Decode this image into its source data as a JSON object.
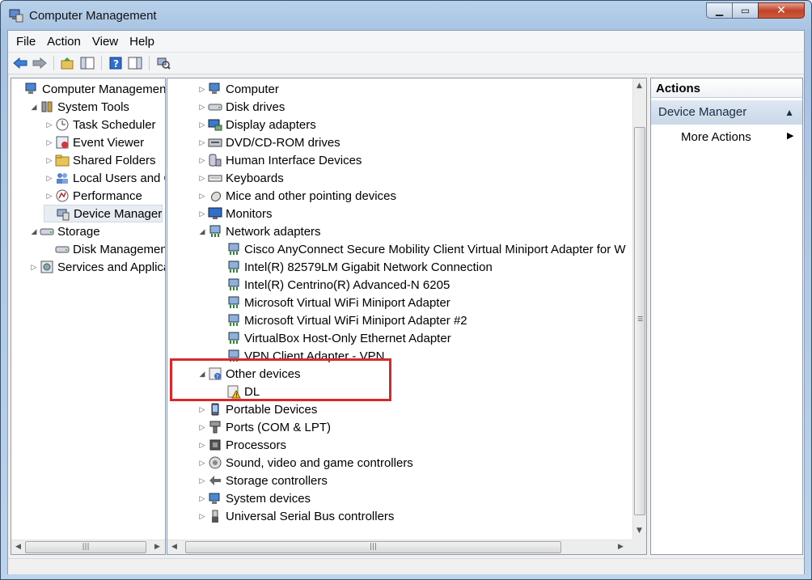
{
  "window": {
    "title": "Computer Management"
  },
  "menu": [
    "File",
    "Action",
    "View",
    "Help"
  ],
  "toolbar": {
    "buttons": [
      "back-icon",
      "forward-icon",
      "up-icon",
      "show-hide-tree-icon",
      "help-icon",
      "properties-icon",
      "scan-hardware-icon"
    ]
  },
  "left_tree": {
    "items": [
      {
        "label": "Computer Management",
        "level": 0,
        "expander": "",
        "icon": "computer-management-icon"
      },
      {
        "label": "System Tools",
        "level": 1,
        "expander": "◢",
        "icon": "tools-icon"
      },
      {
        "label": "Task Scheduler",
        "level": 2,
        "expander": "▷",
        "icon": "clock-icon"
      },
      {
        "label": "Event Viewer",
        "level": 2,
        "expander": "▷",
        "icon": "event-viewer-icon"
      },
      {
        "label": "Shared Folders",
        "level": 2,
        "expander": "▷",
        "icon": "folder-icon"
      },
      {
        "label": "Local Users and Gro",
        "level": 2,
        "expander": "▷",
        "icon": "users-icon"
      },
      {
        "label": "Performance",
        "level": 2,
        "expander": "▷",
        "icon": "performance-icon"
      },
      {
        "label": "Device Manager",
        "level": 2,
        "expander": "",
        "icon": "device-manager-icon",
        "selected": true
      },
      {
        "label": "Storage",
        "level": 1,
        "expander": "◢",
        "icon": "storage-icon"
      },
      {
        "label": "Disk Management",
        "level": 2,
        "expander": "",
        "icon": "disk-icon"
      },
      {
        "label": "Services and Applicat",
        "level": 1,
        "expander": "▷",
        "icon": "services-icon"
      }
    ]
  },
  "device_tree": {
    "items": [
      {
        "label": "Computer",
        "level": 0,
        "expander": "▷",
        "icon": "computer-icon"
      },
      {
        "label": "Disk drives",
        "level": 0,
        "expander": "▷",
        "icon": "disk-drive-icon"
      },
      {
        "label": "Display adapters",
        "level": 0,
        "expander": "▷",
        "icon": "display-adapter-icon"
      },
      {
        "label": "DVD/CD-ROM drives",
        "level": 0,
        "expander": "▷",
        "icon": "dvd-drive-icon"
      },
      {
        "label": "Human Interface Devices",
        "level": 0,
        "expander": "▷",
        "icon": "hid-icon"
      },
      {
        "label": "Keyboards",
        "level": 0,
        "expander": "▷",
        "icon": "keyboard-icon"
      },
      {
        "label": "Mice and other pointing devices",
        "level": 0,
        "expander": "▷",
        "icon": "mouse-icon"
      },
      {
        "label": "Monitors",
        "level": 0,
        "expander": "▷",
        "icon": "monitor-icon"
      },
      {
        "label": "Network adapters",
        "level": 0,
        "expander": "◢",
        "icon": "network-adapter-icon"
      },
      {
        "label": "Cisco AnyConnect Secure Mobility Client Virtual Miniport Adapter for W",
        "level": 1,
        "expander": "",
        "icon": "network-adapter-icon"
      },
      {
        "label": "Intel(R) 82579LM Gigabit Network Connection",
        "level": 1,
        "expander": "",
        "icon": "network-adapter-icon"
      },
      {
        "label": "Intel(R) Centrino(R) Advanced-N 6205",
        "level": 1,
        "expander": "",
        "icon": "network-adapter-icon"
      },
      {
        "label": "Microsoft Virtual WiFi Miniport Adapter",
        "level": 1,
        "expander": "",
        "icon": "network-adapter-icon"
      },
      {
        "label": "Microsoft Virtual WiFi Miniport Adapter #2",
        "level": 1,
        "expander": "",
        "icon": "network-adapter-icon"
      },
      {
        "label": "VirtualBox Host-Only Ethernet Adapter",
        "level": 1,
        "expander": "",
        "icon": "network-adapter-icon"
      },
      {
        "label": "VPN Client Adapter - VPN",
        "level": 1,
        "expander": "",
        "icon": "network-adapter-icon"
      },
      {
        "label": "Other devices",
        "level": 0,
        "expander": "◢",
        "icon": "unknown-device-icon"
      },
      {
        "label": "DL",
        "level": 1,
        "expander": "",
        "icon": "warning-device-icon"
      },
      {
        "label": "Portable Devices",
        "level": 0,
        "expander": "▷",
        "icon": "portable-device-icon"
      },
      {
        "label": "Ports (COM & LPT)",
        "level": 0,
        "expander": "▷",
        "icon": "port-icon"
      },
      {
        "label": "Processors",
        "level": 0,
        "expander": "▷",
        "icon": "processor-icon"
      },
      {
        "label": "Sound, video and game controllers",
        "level": 0,
        "expander": "▷",
        "icon": "sound-icon"
      },
      {
        "label": "Storage controllers",
        "level": 0,
        "expander": "▷",
        "icon": "storage-controller-icon"
      },
      {
        "label": "System devices",
        "level": 0,
        "expander": "▷",
        "icon": "system-device-icon"
      },
      {
        "label": "Universal Serial Bus controllers",
        "level": 0,
        "expander": "▷",
        "icon": "usb-icon"
      }
    ]
  },
  "actions": {
    "header": "Actions",
    "section": "Device Manager",
    "more": "More Actions"
  },
  "colors": {
    "highlight_box": "#d8282c",
    "selection": "#e8edf3"
  }
}
